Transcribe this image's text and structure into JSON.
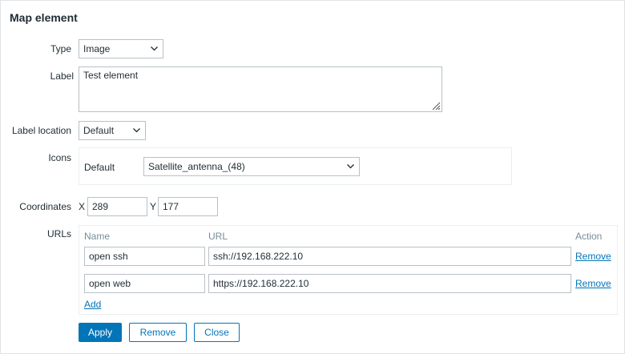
{
  "dialog": {
    "title": "Map element"
  },
  "form": {
    "type": {
      "label": "Type",
      "value": "Image"
    },
    "label": {
      "label": "Label",
      "value": "Test element"
    },
    "label_location": {
      "label": "Label location",
      "value": "Default"
    },
    "icons": {
      "label": "Icons",
      "default_label": "Default",
      "default_value": "Satellite_antenna_(48)"
    },
    "coordinates": {
      "label": "Coordinates",
      "x_label": "X",
      "x_value": "289",
      "y_label": "Y",
      "y_value": "177"
    },
    "urls": {
      "label": "URLs",
      "columns": {
        "name": "Name",
        "url": "URL",
        "action": "Action"
      },
      "rows": [
        {
          "name": "open ssh",
          "url": "ssh://192.168.222.10",
          "action": "Remove"
        },
        {
          "name": "open web",
          "url": "https://192.168.222.10",
          "action": "Remove"
        }
      ],
      "add_label": "Add"
    }
  },
  "buttons": {
    "apply": "Apply",
    "remove": "Remove",
    "close": "Close"
  },
  "colors": {
    "accent": "#0275b8",
    "border": "#b8c1c6",
    "header_text": "#768d99"
  }
}
